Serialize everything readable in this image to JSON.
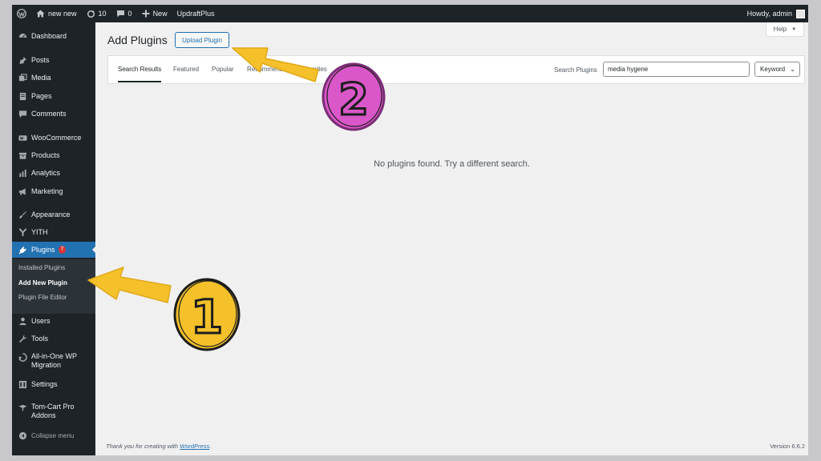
{
  "adminbar": {
    "site_name": "new new",
    "updates_count": "10",
    "comments_count": "0",
    "new_label": "New",
    "updraft_label": "UpdraftPlus",
    "howdy": "Howdy, admin"
  },
  "sidebar": {
    "dashboard": "Dashboard",
    "posts": "Posts",
    "media": "Media",
    "pages": "Pages",
    "comments": "Comments",
    "woocommerce": "WooCommerce",
    "products": "Products",
    "analytics": "Analytics",
    "marketing": "Marketing",
    "appearance": "Appearance",
    "yith": "YITH",
    "plugins": "Plugins",
    "plugins_badge": "7",
    "submenu": {
      "installed": "Installed Plugins",
      "add_new": "Add New Plugin",
      "file_editor": "Plugin File Editor"
    },
    "users": "Users",
    "tools": "Tools",
    "aiowp_line1": "All-in-One WP",
    "aiowp_line2": "Migration",
    "settings": "Settings",
    "tomcart_line1": "Tom-Cart Pro",
    "tomcart_line2": "Addons",
    "collapse": "Collapse menu"
  },
  "main": {
    "help": "Help",
    "title": "Add Plugins",
    "upload_button": "Upload Plugin",
    "tabs": {
      "search_results": "Search Results",
      "featured": "Featured",
      "popular": "Popular",
      "recommended": "Recommended",
      "favorites": "Favorites"
    },
    "search_label": "Search Plugins",
    "search_value": "media hygene",
    "search_type": "Keyword",
    "empty_message": "No plugins found. Try a different search.",
    "footer_text": "Thank you for creating with ",
    "footer_link": "WordPress",
    "footer_period": ".",
    "version": "Version 6.6.2"
  },
  "annotations": {
    "step1": "1",
    "step2": "2",
    "arrow_color": "#f5c12a",
    "circle1_color": "#f5c12a",
    "circle2_color": "#d957c8"
  }
}
